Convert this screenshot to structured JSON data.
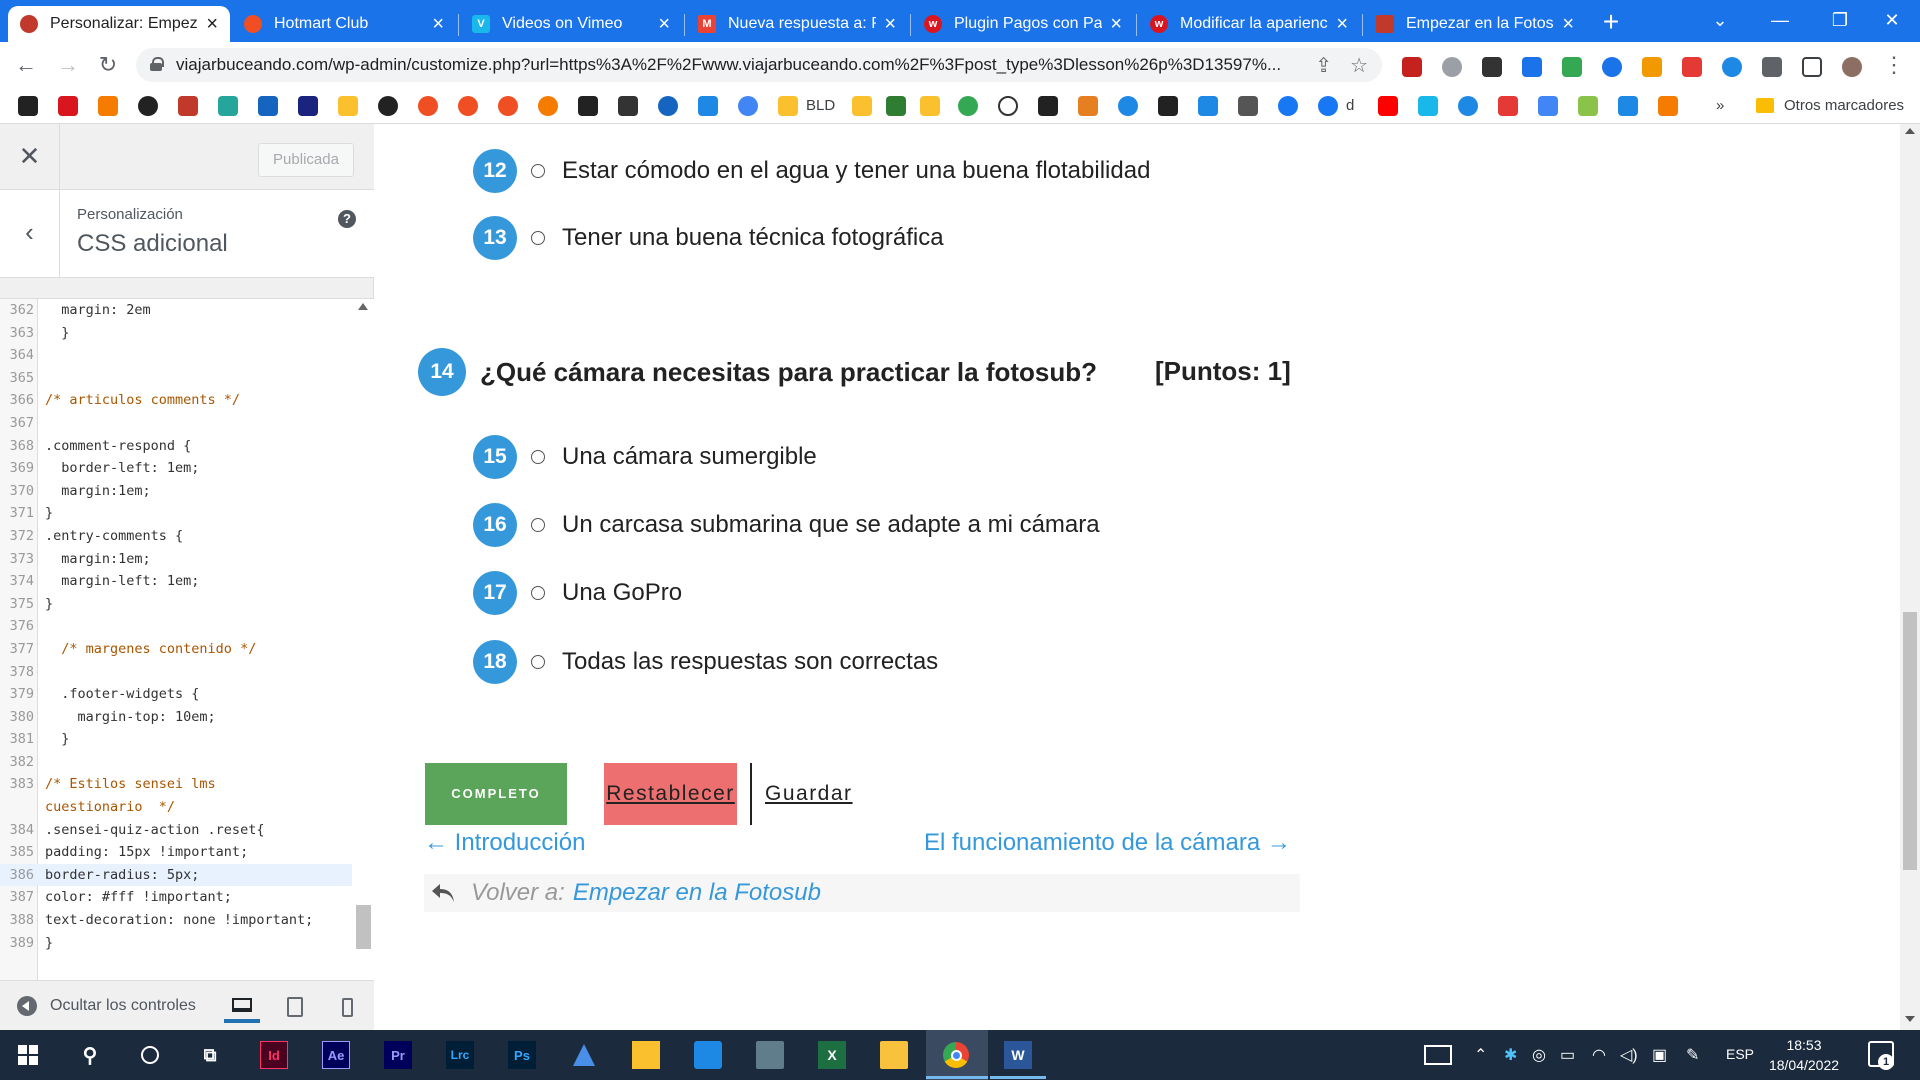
{
  "browser": {
    "tabs": [
      {
        "title": "Personalizar: Empezar",
        "favicon_color": "#c0392b",
        "active": true
      },
      {
        "title": "Hotmart Club",
        "favicon_color": "#f04e23",
        "active": false
      },
      {
        "title": "Videos on Vimeo",
        "favicon_color": "#1ab7ea",
        "active": false
      },
      {
        "title": "Nueva respuesta a: Pl",
        "favicon_color": "#ea4335",
        "active": false
      },
      {
        "title": "Plugin Pagos con Payl",
        "favicon_color": "#d9151f",
        "active": false
      },
      {
        "title": "Modificar la aparienci",
        "favicon_color": "#d9151f",
        "active": false
      },
      {
        "title": "Empezar en la Fotosub",
        "favicon_color": "#c0392b",
        "active": false
      }
    ],
    "url": "viajarbuceando.com/wp-admin/customize.php?url=https%3A%2F%2Fwww.viajarbuceando.com%2F%3Fpost_type%3Dlesson%26p%3D13597%...",
    "bookmark_labels": {
      "bld": "BLD",
      "d": "d",
      "more": "»",
      "other": "Otros marcadores"
    }
  },
  "customizer": {
    "publish_label": "Publicada",
    "breadcrumb": "Personalización",
    "section_title": "CSS adicional",
    "help_glyph": "?",
    "hide_controls_label": "Ocultar los controles",
    "code_lines": [
      {
        "n": "362",
        "t": "  margin: 2em"
      },
      {
        "n": "363",
        "t": "  }"
      },
      {
        "n": "364",
        "t": ""
      },
      {
        "n": "365",
        "t": ""
      },
      {
        "n": "366",
        "t": "/* articulos comments */",
        "c": "comment"
      },
      {
        "n": "367",
        "t": ""
      },
      {
        "n": "368",
        "t": ".comment-respond {"
      },
      {
        "n": "369",
        "t": "  border-left: 1em;"
      },
      {
        "n": "370",
        "t": "  margin:1em;"
      },
      {
        "n": "371",
        "t": "}"
      },
      {
        "n": "372",
        "t": ".entry-comments {"
      },
      {
        "n": "373",
        "t": "  margin:1em;"
      },
      {
        "n": "374",
        "t": "  margin-left: 1em;"
      },
      {
        "n": "375",
        "t": "}"
      },
      {
        "n": "376",
        "t": ""
      },
      {
        "n": "377",
        "t": "  /* margenes contenido */",
        "c": "comment"
      },
      {
        "n": "378",
        "t": ""
      },
      {
        "n": "379",
        "t": "  .footer-widgets {"
      },
      {
        "n": "380",
        "t": "    margin-top: 10em;"
      },
      {
        "n": "381",
        "t": "  }"
      },
      {
        "n": "382",
        "t": ""
      },
      {
        "n": "383",
        "t": "/* Estilos sensei lms",
        "c": "comment"
      },
      {
        "n": "",
        "t": "cuestionario  */",
        "c": "comment"
      },
      {
        "n": "384",
        "t": ".sensei-quiz-action .reset{"
      },
      {
        "n": "385",
        "t": "padding: 15px !important;"
      },
      {
        "n": "386",
        "t": "border-radius: 5px;",
        "hl": true
      },
      {
        "n": "387",
        "t": "color: #fff !important;"
      },
      {
        "n": "388",
        "t": "text-decoration: none !important;"
      },
      {
        "n": "389",
        "t": "}"
      }
    ]
  },
  "quiz": {
    "answers_top": [
      {
        "num": "12",
        "text": "Estar cómodo en el agua y tener una buena flotabilidad"
      },
      {
        "num": "13",
        "text": "Tener una buena técnica fotográfica"
      }
    ],
    "question": {
      "num": "14",
      "text": "¿Qué cámara necesitas para practicar la fotosub?",
      "points": "[Puntos: 1]"
    },
    "answers": [
      {
        "num": "15",
        "text": "Una cámara sumergible"
      },
      {
        "num": "16",
        "text": "Un carcasa submarina que se adapte a mi cámara"
      },
      {
        "num": "17",
        "text": "Una GoPro"
      },
      {
        "num": "18",
        "text": "Todas las respuestas son correctas"
      }
    ],
    "buttons": {
      "complete": "COMPLETO",
      "reset": "Restablecer",
      "save": "Guardar"
    },
    "nav": {
      "prev": "← Introducción",
      "next": "El funcionamiento de la cámara →",
      "back_label": "Volver a:",
      "back_link": "Empezar en la Fotosub"
    },
    "badge_color": "#3498db"
  },
  "taskbar": {
    "apps": [
      "Id",
      "Ae",
      "Pr",
      "Lrc",
      "Ps"
    ],
    "lang": "ESP",
    "time": "18:53",
    "date": "18/04/2022",
    "notification_count": "1"
  }
}
